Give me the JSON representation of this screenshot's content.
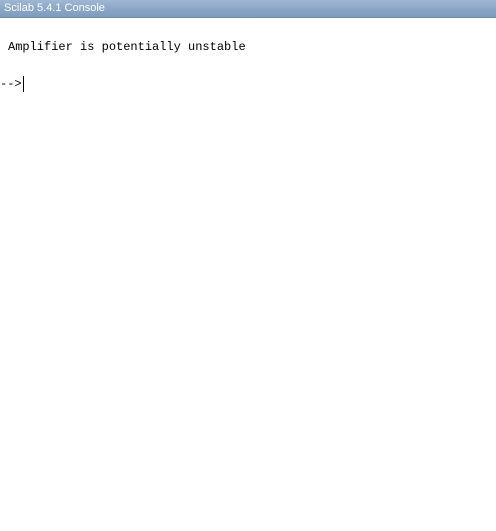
{
  "window": {
    "title": "Scilab 5.4.1 Console"
  },
  "console": {
    "output_lines": [
      "Amplifier is potentially unstable"
    ],
    "prompt": "-->",
    "input_value": ""
  }
}
